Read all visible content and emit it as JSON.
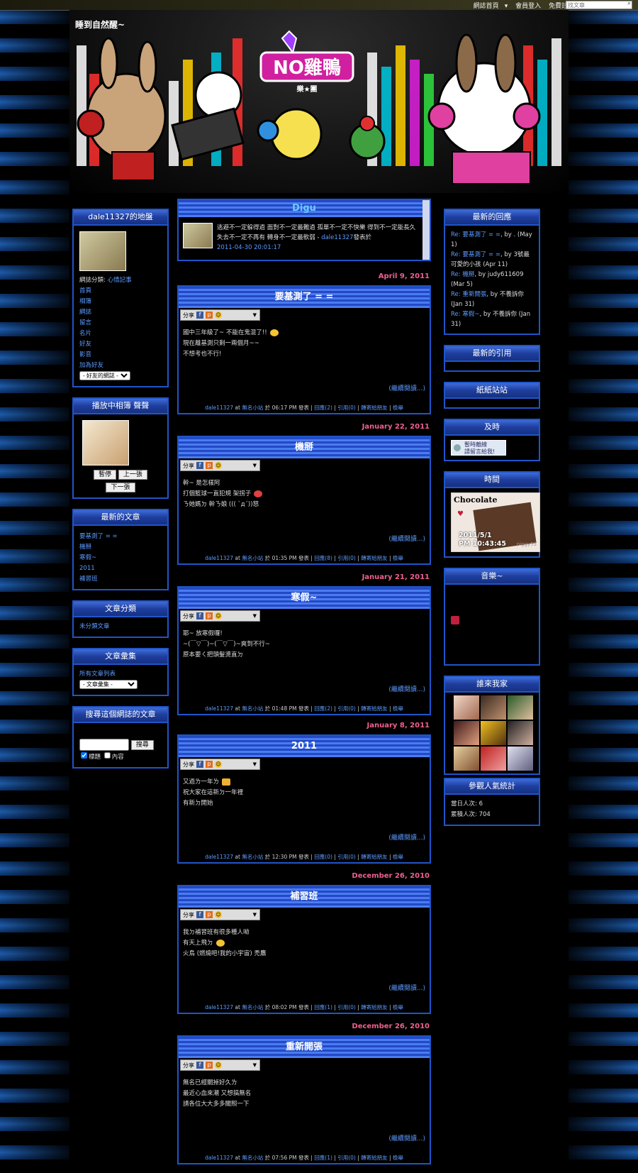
{
  "topbar": {
    "portal": "網誌首頁",
    "login": "會員登入",
    "register": "免費註冊",
    "search_placeholder": "找文章"
  },
  "blog": {
    "title": "睡到自然醒~",
    "logo_text": "NO雞鴨",
    "logo_sub": "樂★團"
  },
  "sidebar_left": {
    "profile": {
      "header": "dale11327的地盤",
      "category_label": "網誌分類:",
      "category_value": "心情記事",
      "links": [
        "首頁",
        "相簿",
        "網誌",
        "留言",
        "名片",
        "好友",
        "影音",
        "加為好友"
      ],
      "friends_select": "- 好友的網誌 -"
    },
    "album": {
      "header": "播放中相簿  聲聲",
      "pause": "暫停",
      "prev": "上一張",
      "next": "下一張"
    },
    "recent_posts": {
      "header": "最新的文章",
      "items": [
        "要基測了 = =",
        "機掰",
        "寒假~",
        "2011",
        "補習班"
      ]
    },
    "categories": {
      "header": "文章分類",
      "items": [
        "未分類文章"
      ]
    },
    "archive": {
      "header": "文章彙集",
      "all": "所有文章列表",
      "select": "- 文章彙集 -"
    },
    "search": {
      "header": "搜尋這個網誌的文章",
      "button": "搜尋",
      "opt_title": "標題",
      "opt_content": "內容"
    }
  },
  "digu": {
    "title": "Digu",
    "text": "逃避不一定躲得過 面對不一定最難過 孤單不一定不快樂 得到不一定能長久 失去不一定不再有 轉身不一定最軟弱 - ",
    "user": "dale11327",
    "suffix": "發表於",
    "time": "2011-04-30 20:01:17"
  },
  "posts": [
    {
      "date": "April 9, 2011",
      "title": "要基測了 = =",
      "lines": [
        "國中三年級了~ 不能在鬼混了!!",
        "現在離基測只剩一兩個月~~",
        "不想考也不行!"
      ],
      "more": "(繼續閱讀...)",
      "foot_author": "dale11327",
      "foot_mid1": "at",
      "foot_blog": "無名小站",
      "foot_time": "於 06:17 PM 發表",
      "foot_reply": "回應(2)",
      "foot_ref": "引用(0)",
      "foot_recommend": "轉寄給朋友",
      "foot_report": "檢舉"
    },
    {
      "date": "January 22, 2011",
      "title": "機掰",
      "lines": [
        "幹~  是怎樣阿",
        "打個籃球一直犯規 架拐子",
        "ㄋ她媽ㄉ 幹ㄋ娘   ((( `д´))怒"
      ],
      "more": "(繼續閱讀...)",
      "foot_author": "dale11327",
      "foot_mid1": "at",
      "foot_blog": "無名小站",
      "foot_time": "於 01:35 PM 發表",
      "foot_reply": "回應(8)",
      "foot_ref": "引用(0)",
      "foot_recommend": "轉寄給朋友",
      "foot_report": "檢舉"
    },
    {
      "date": "January 21, 2011",
      "title": "寒假~",
      "lines": [
        "耶~ 放寒假囉!",
        "~(￣▽￣)~(￣▽￣)~爽到不行~",
        "原本要ㄑ把頭髮燙直ㄉ"
      ],
      "more": "(繼續閱讀...)",
      "foot_author": "dale11327",
      "foot_mid1": "at",
      "foot_blog": "無名小站",
      "foot_time": "於 01:48 PM 發表",
      "foot_reply": "回應(2)",
      "foot_ref": "引用(0)",
      "foot_recommend": "轉寄給朋友",
      "foot_report": "檢舉"
    },
    {
      "date": "January 8, 2011",
      "title": "2011",
      "lines": [
        "又過ㄌ一年ㄌ",
        "祝大家在這新ㄉ一年裡",
        "有新ㄉ開始"
      ],
      "more": "(繼續閱讀...)",
      "foot_author": "dale11327",
      "foot_mid1": "at",
      "foot_blog": "無名小站",
      "foot_time": "於 12:30 PM 發表",
      "foot_reply": "回應(0)",
      "foot_ref": "引用(0)",
      "foot_recommend": "轉寄給朋友",
      "foot_report": "檢舉"
    },
    {
      "date": "December 26, 2010",
      "title": "補習班",
      "lines": [
        "我ㄉ補習班有很多種人呦",
        "  有天上飛ㄉ",
        "火鳥 (燃燒吧!我的小宇宙) 禿鷹"
      ],
      "more": "(繼續閱讀...)",
      "foot_author": "dale11327",
      "foot_mid1": "at",
      "foot_blog": "無名小站",
      "foot_time": "於 08:02 PM 發表",
      "foot_reply": "回應(1)",
      "foot_ref": "引用(0)",
      "foot_recommend": "轉寄給朋友",
      "foot_report": "檢舉"
    },
    {
      "date": "December 26, 2010",
      "title": "重新開張",
      "lines": [
        "無名已經關掉好久ㄌ",
        "最近心血來潮   又想搞無名",
        "請各位大大多多關照一下"
      ],
      "more": "(繼續閱讀...)",
      "foot_author": "dale11327",
      "foot_mid1": "at",
      "foot_blog": "無名小站",
      "foot_time": "於 07:56 PM 發表",
      "foot_reply": "回應(1)",
      "foot_ref": "引用(0)",
      "foot_recommend": "轉寄給朋友",
      "foot_report": "檢舉"
    }
  ],
  "share_label": "分享",
  "sidebar_right": {
    "replies": {
      "header": "最新的回應",
      "items": [
        {
          "link": "Re: 要基測了 = =",
          "rest": ", by . (May 1)"
        },
        {
          "link": "Re: 要基測了 = =",
          "rest": ", by 3號最可愛的小孩 (Apr 11)"
        },
        {
          "link": "Re: 機掰",
          "rest": ", by judy611609 (Mar 5)"
        },
        {
          "link": "Re: 重新開張",
          "rest": ", by 不養訴你 (Jan 31)"
        },
        {
          "link": "Re: 寒假~",
          "rest": ", by 不養訴你 (Jan 31)"
        }
      ]
    },
    "refs": {
      "header": "最新的引用"
    },
    "paper": {
      "header": "紙紙站站"
    },
    "instant": {
      "header": "及時",
      "line1": "暫時離線",
      "line2": "請留言給我!"
    },
    "clock": {
      "header": "時間",
      "brand": "Chocolate",
      "date": "2011/5/1",
      "time": "PM 10:43:45",
      "sig": "piggy53"
    },
    "music": {
      "header": "音樂~"
    },
    "visitors": {
      "header": "誰來我家"
    },
    "stats": {
      "header": "參觀人氣統計",
      "today": "當日人次: 6",
      "total": "累積人次: 704"
    }
  },
  "colors": {
    "accent": "#1f55c8",
    "date": "#f06090",
    "link": "#5d9bff"
  }
}
